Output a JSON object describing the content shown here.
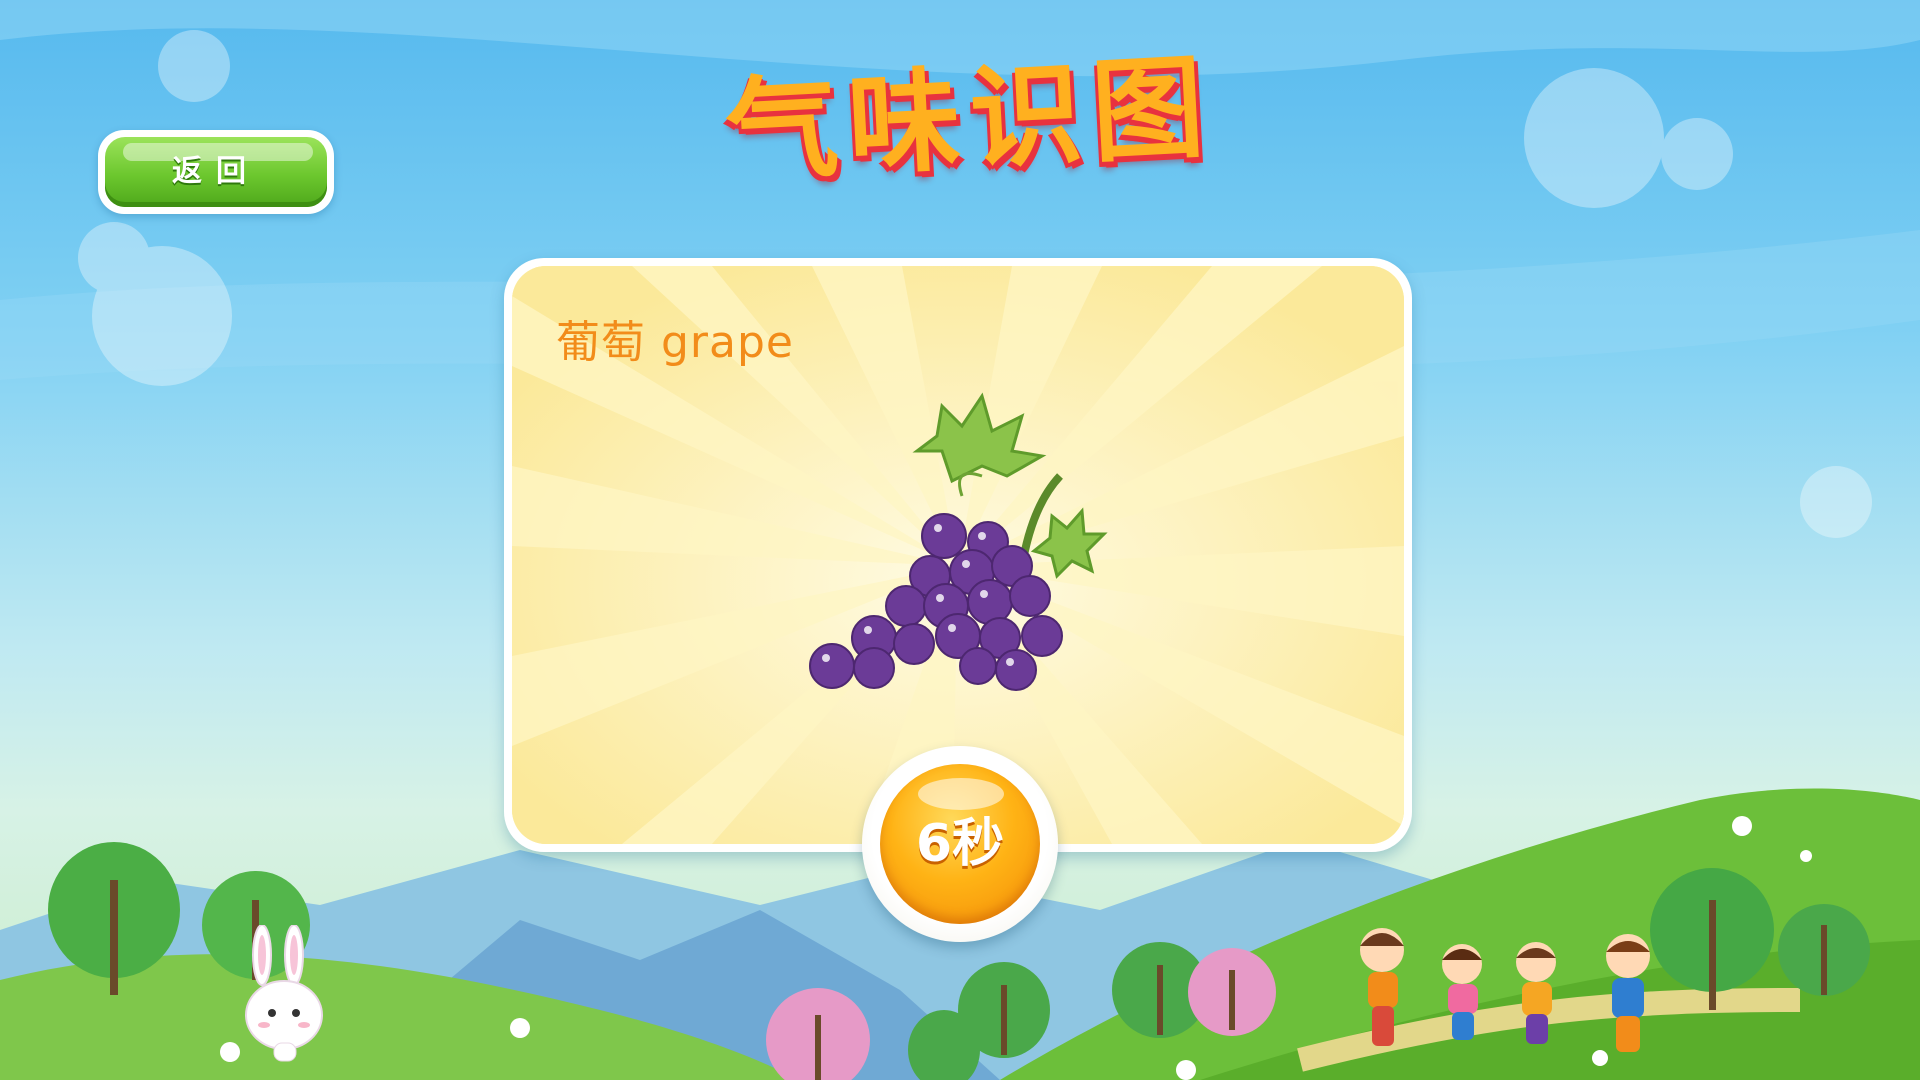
{
  "title": "气味识图",
  "back_button": {
    "label": "返回"
  },
  "card": {
    "word": "葡萄 grape",
    "image": "grape-illustration"
  },
  "timer": {
    "label": "6秒"
  },
  "characters": [
    "rabbit",
    "children-group"
  ],
  "colors": {
    "title_fill": "#ffb01f",
    "title_outline": "#e8323f",
    "back_button": "#6cc72e",
    "word": "#f28c1a",
    "timer": "#ffb315",
    "grape": "#6b3b97"
  }
}
